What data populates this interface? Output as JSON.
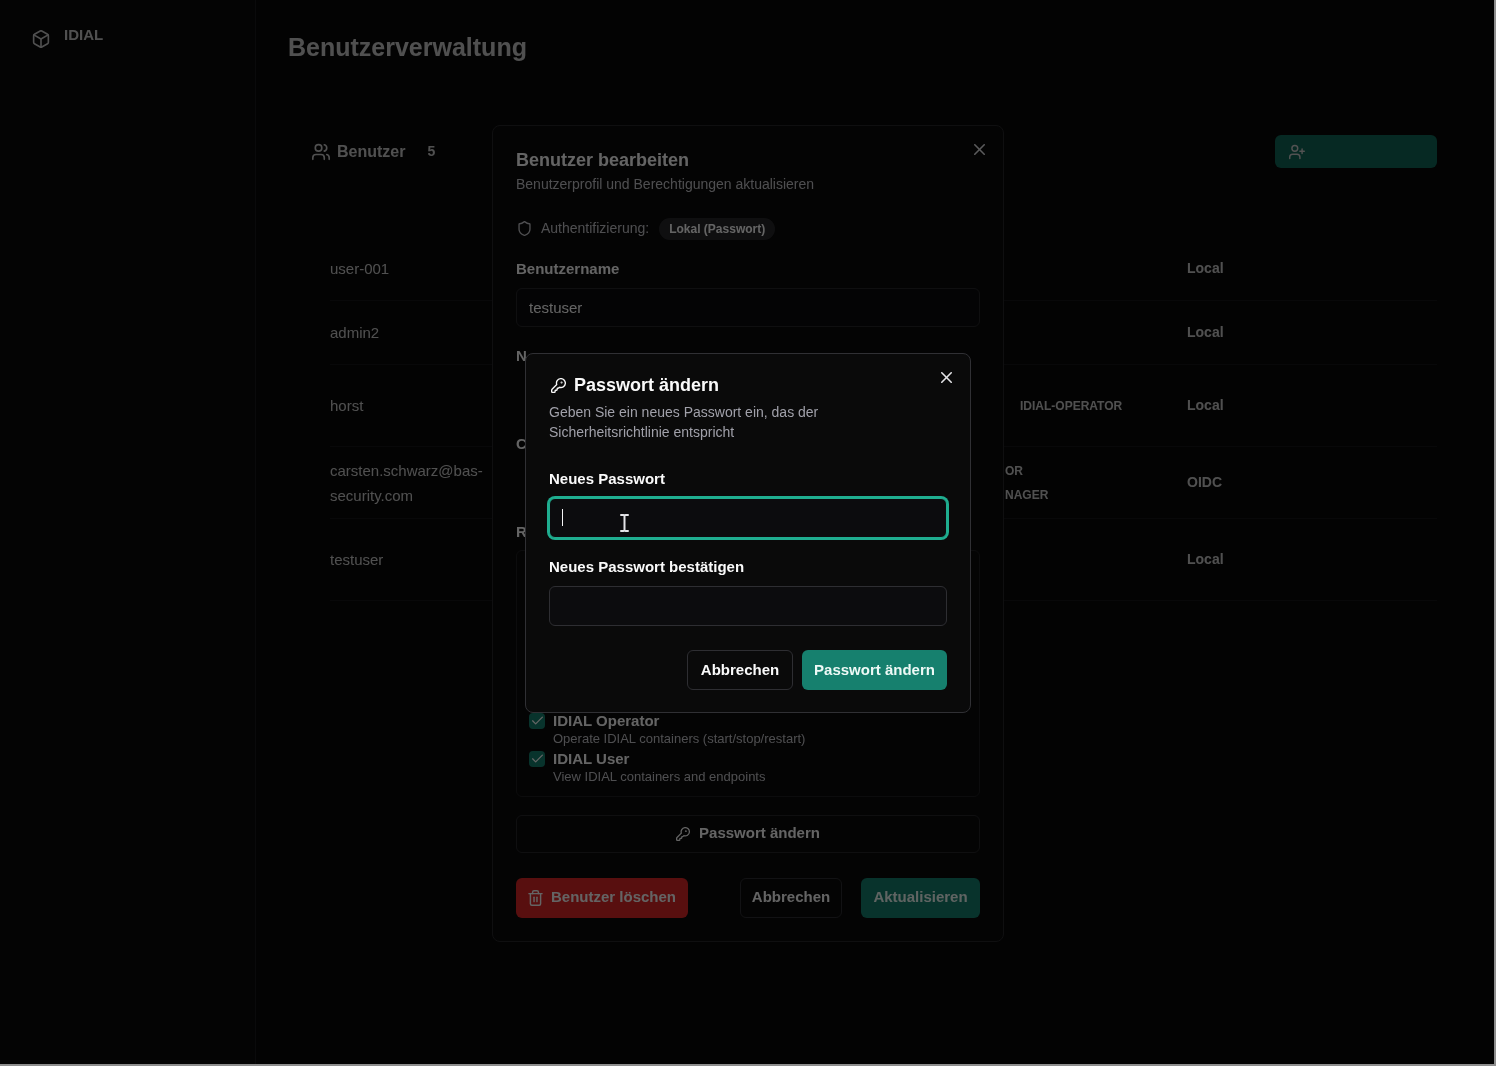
{
  "sidebar": {
    "logo": "IDIAL"
  },
  "page": {
    "title": "Benutzerverwaltung",
    "users_tab": {
      "label": "Benutzer",
      "count": "5"
    },
    "users_table": {
      "rows": [
        {
          "username": "user-001",
          "auth": "Local"
        },
        {
          "username": "admin2",
          "auth": "Local"
        },
        {
          "username": "horst",
          "roles": [
            "IDIAL-OPERATOR"
          ],
          "auth": "Local"
        },
        {
          "username": "carsten.schwarz@bas-security.com",
          "roles": [
            "OR",
            "NAGER"
          ],
          "auth": "OIDC"
        },
        {
          "username": "testuser",
          "auth": "Local"
        }
      ]
    }
  },
  "edit_dialog": {
    "title": "Benutzer bearbeiten",
    "subtitle": "Benutzerprofil und Berechtigungen aktualisieren",
    "auth_label": "Authentifizierung:",
    "auth_badge": "Lokal (Passwort)",
    "username": {
      "label": "Benutzername",
      "value": "testuser"
    },
    "cut_labels": [
      "N",
      "C",
      "R"
    ],
    "roles": [
      {
        "name": "IDIAL Operator",
        "description": "Operate IDIAL containers (start/stop/restart)",
        "checked": true
      },
      {
        "name": "IDIAL User",
        "description": "View IDIAL containers and endpoints",
        "checked": true
      }
    ],
    "change_password_button": "Passwort ändern",
    "buttons": [
      {
        "label": "Benutzer löschen",
        "kind": "danger"
      },
      {
        "label": "Abbrechen",
        "kind": "secondary"
      },
      {
        "label": "Aktualisieren",
        "kind": "primary"
      }
    ]
  },
  "password_dialog": {
    "title": "Passwort ändern",
    "description": "Geben Sie ein neues Passwort ein, das der Sicherheitsrichtlinie entspricht",
    "fields": [
      {
        "label": "Neues Passwort",
        "focused": true
      },
      {
        "label": "Neues Passwort bestätigen",
        "focused": false
      }
    ],
    "mouse_pointer": {
      "kind": "i-beam"
    },
    "buttons": [
      {
        "label": "Abbrechen",
        "kind": "secondary"
      },
      {
        "label": "Passwort ändern",
        "kind": "primary"
      }
    ]
  }
}
